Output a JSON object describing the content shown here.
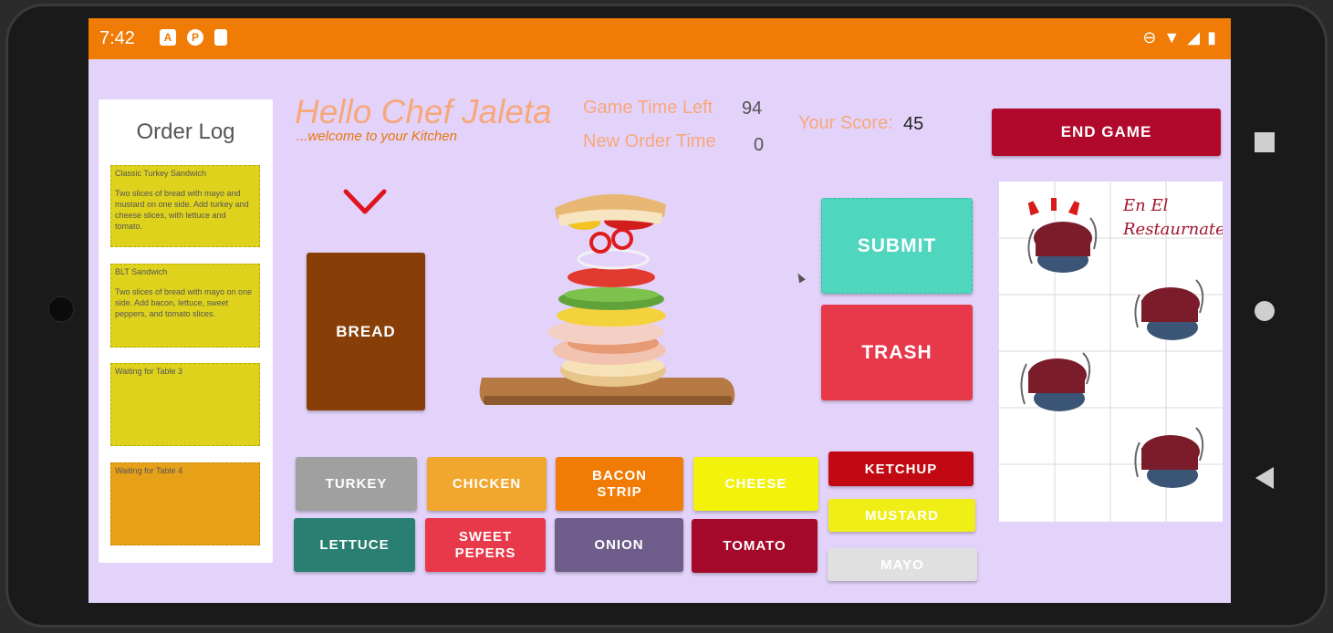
{
  "status_bar": {
    "time": "7:42",
    "left_icons": [
      "a-icon",
      "p-icon",
      "sd-card-icon"
    ],
    "right_icons": [
      "dnd-icon",
      "wifi-icon",
      "signal-icon",
      "battery-icon"
    ]
  },
  "order_log": {
    "title": "Order Log",
    "tickets": [
      {
        "title": "Classic Turkey Sandwich",
        "body": "Two slices of bread with mayo and mustard on one side. Add turkey and cheese slices, with lettuce and tomato.",
        "color": "#dfd21d"
      },
      {
        "title": "BLT Sandwich",
        "body": "Two slices of bread with mayo on one side. Add bacon, lettuce, sweet peppers, and tomato slices.",
        "color": "#dfd21d"
      },
      {
        "title": "Waiting for Table 3",
        "body": "",
        "color": "#dfd21d"
      },
      {
        "title": "Waiting for Table 4",
        "body": "",
        "color": "#e6a119"
      }
    ]
  },
  "header": {
    "greeting": "Hello Chef Jaleta",
    "subtitle": "...welcome to your Kitchen",
    "game_time_label": "Game Time Left",
    "game_time_value": "94",
    "new_order_label": "New Order Time",
    "new_order_value": "0",
    "score_label": "Your Score:",
    "score_value": "45"
  },
  "buttons": {
    "end_game": "END GAME",
    "submit": "SUBMIT",
    "trash": "TRASH",
    "bread": "BREAD"
  },
  "ingredients": [
    {
      "label": "TURKEY",
      "color": "#a0a0a0"
    },
    {
      "label": "CHICKEN",
      "color": "#f1a62d"
    },
    {
      "label": "BACON\nSTRIP",
      "color": "#f07b05"
    },
    {
      "label": "CHEESE",
      "color": "#f2f20a"
    },
    {
      "label": "LETTUCE",
      "color": "#2a7f73"
    },
    {
      "label": "SWEET\nPEPERS",
      "color": "#e8394b"
    },
    {
      "label": "ONION",
      "color": "#6e5d8a"
    },
    {
      "label": "TOMATO",
      "color": "#a5092a"
    }
  ],
  "sauces": [
    {
      "label": "KETCHUP",
      "color": "#c20913"
    },
    {
      "label": "MUSTARD",
      "color": "#f0ee17"
    },
    {
      "label": "MAYO",
      "color": "#e0e0e0"
    }
  ],
  "restaurant": {
    "title_line1": "En El",
    "title_line2": "Restaurnate"
  },
  "colors": {
    "status_bar": "#f07b05",
    "background": "#e3d3fb",
    "accent": "#b0092c"
  }
}
